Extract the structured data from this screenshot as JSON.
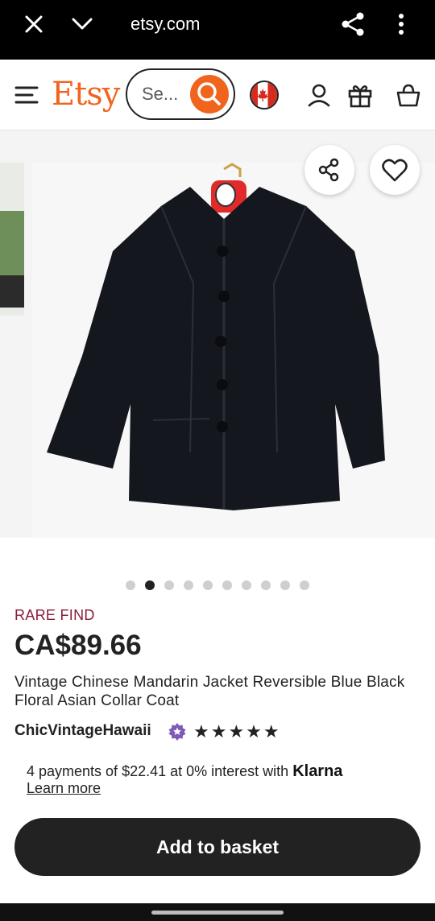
{
  "browser": {
    "url": "etsy.com"
  },
  "header": {
    "logo": "Etsy",
    "search_placeholder": "Se..."
  },
  "colors": {
    "brand_orange": "#f1641e",
    "rare_find": "#8c1d3a",
    "primary_button": "#222222"
  },
  "gallery": {
    "dot_count": 10,
    "active_dot": 2
  },
  "listing": {
    "badge": "RARE FIND",
    "price": "CA$89.66",
    "title": "Vintage Chinese Mandarin Jacket Reversible Blue Black Floral Asian Collar Coat",
    "shop_name": "ChicVintageHawaii",
    "rating_stars": "★★★★★",
    "rating": 5
  },
  "payments": {
    "text": "4 payments of $22.41 at 0% interest with ",
    "provider": "Klarna",
    "learn_more": "Learn more"
  },
  "actions": {
    "add_to_basket": "Add to basket"
  },
  "icons": [
    "close-icon",
    "chevron-down-icon",
    "share-icon",
    "more-vert-icon",
    "menu-icon",
    "search-icon",
    "canada-flag-icon",
    "account-icon",
    "gift-icon",
    "basket-icon",
    "heart-icon",
    "star-seller-icon"
  ]
}
